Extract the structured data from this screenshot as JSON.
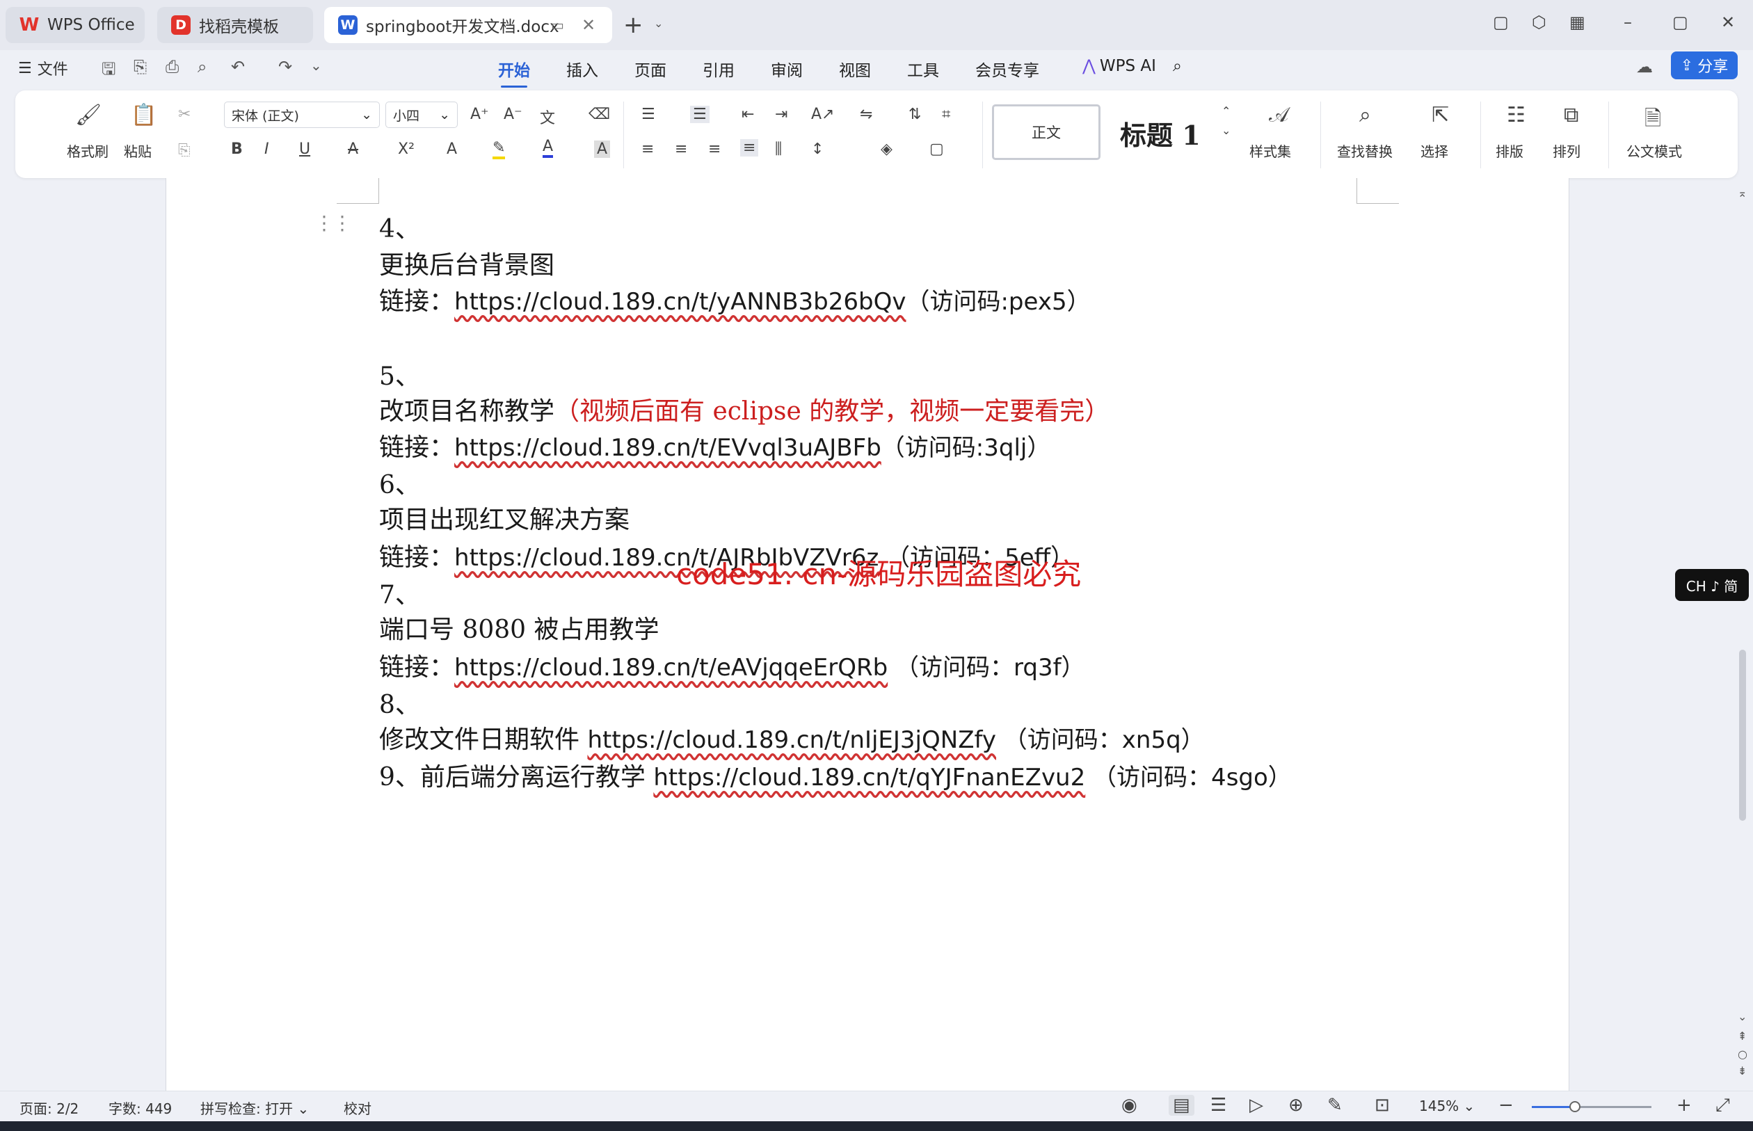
{
  "tabs": {
    "wps_office": "WPS Office",
    "template": "找稻壳模板",
    "document": "springboot开发文档.docx"
  },
  "menu": {
    "file": "文件",
    "tabs": [
      "开始",
      "插入",
      "页面",
      "引用",
      "审阅",
      "视图",
      "工具",
      "会员专享"
    ],
    "active_tab": "开始",
    "wps_ai": "WPS AI",
    "share": "分享"
  },
  "ribbon": {
    "format_painter": "格式刷",
    "paste": "粘贴",
    "font_name": "宋体 (正文)",
    "font_size": "小四",
    "style_normal": "正文",
    "style_heading": "标题 1",
    "style_set": "样式集",
    "find_replace": "查找替换",
    "select": "选择",
    "layout": "排版",
    "arrange": "排列",
    "official_mode": "公文模式"
  },
  "document": {
    "lines": [
      {
        "id": "l1",
        "text": "4、"
      },
      {
        "id": "l2",
        "text": "更换后台背景图"
      },
      {
        "id": "l3",
        "prefix": "链接：",
        "url": "https://cloud.189.cn/t/yANNB3b26bQv",
        "suffix": "（访问码:pex5）"
      },
      {
        "id": "l4",
        "text": "5、"
      },
      {
        "id": "l5",
        "text": "改项目名称教学",
        "red_text": "（视频后面有 eclipse 的教学，视频一定要看完）"
      },
      {
        "id": "l6",
        "prefix": "链接：",
        "url": "https://cloud.189.cn/t/EVvql3uAJBFb",
        "suffix": "（访问码:3qlj）"
      },
      {
        "id": "l7",
        "text": "6、"
      },
      {
        "id": "l8",
        "text": "项目出现红叉解决方案"
      },
      {
        "id": "l9",
        "prefix": "链接：",
        "url": "https://cloud.189.cn/t/AJRbIbVZVr6z",
        "suffix": " （访问码：5eff）"
      },
      {
        "id": "l10",
        "text": "7、"
      },
      {
        "id": "l11",
        "text": "端口号 8080 被占用教学"
      },
      {
        "id": "l12",
        "prefix": "链接：",
        "url": "https://cloud.189.cn/t/eAVjqqeErQRb",
        "suffix": " （访问码：rq3f）"
      },
      {
        "id": "l13",
        "text": "8、"
      },
      {
        "id": "l14",
        "prefix": "修改文件日期软件 ",
        "url": "https://cloud.189.cn/t/nIjEJ3jQNZfy",
        "suffix": " （访问码：xn5q）"
      },
      {
        "id": "l15",
        "prefix": "9、前后端分离运行教学 ",
        "url": "https://cloud.189.cn/t/qYJFnanEZvu2",
        "suffix": " （访问码：4sgo）"
      }
    ],
    "overlay_text": "code51. cn-源码乐园盗图必究"
  },
  "ime": "CH ♪ 简",
  "status": {
    "page": "页面: 2/2",
    "words": "字数: 449",
    "spell": "拼写检查: 打开",
    "proof": "校对",
    "zoom": "145%",
    "zoom_fraction": 0.36
  },
  "colors": {
    "accent": "#2b62d6",
    "red_text": "#cc1f1f",
    "share_bg": "#2b6de0"
  }
}
